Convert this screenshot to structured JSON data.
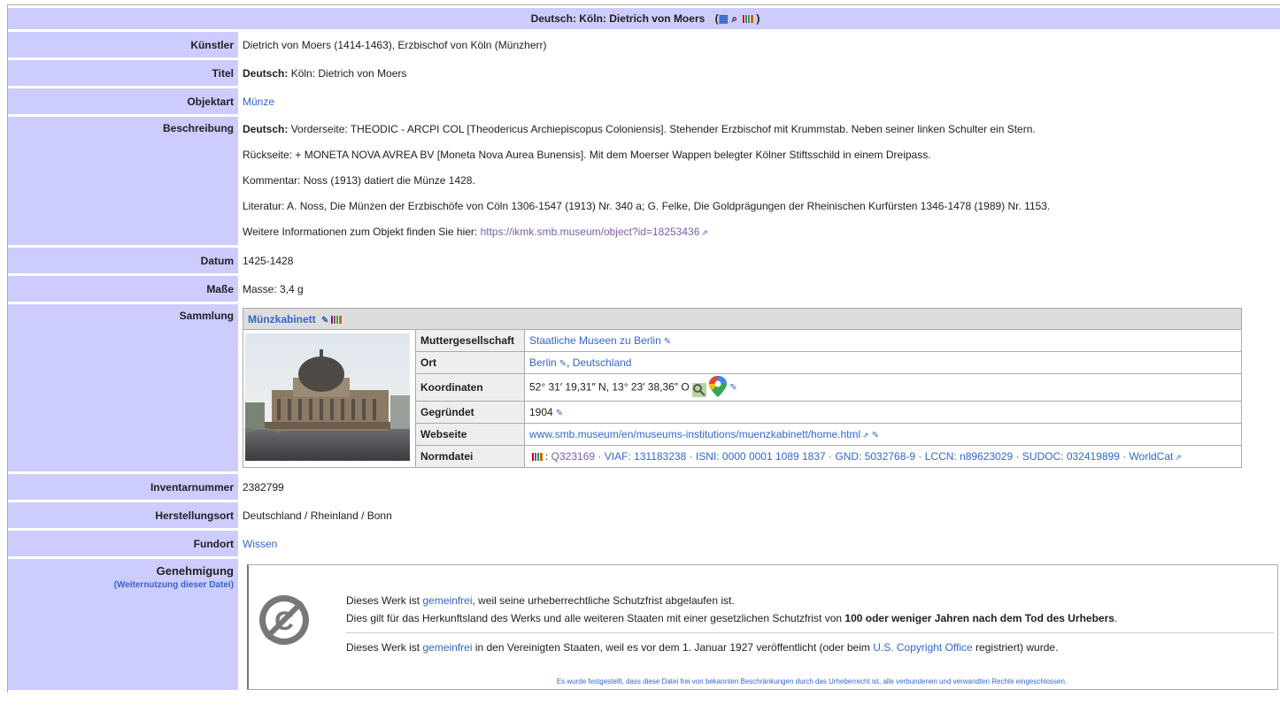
{
  "header": {
    "title": "Deutsch: Köln: Dietrich von Moers",
    "icons": [
      "map-icon",
      "search-icon",
      "barcode-icon"
    ]
  },
  "rows": {
    "kuenstler": {
      "label": "Künstler",
      "value": "Dietrich von Moers (1414-1463), Erzbischof von Köln (Münzherr)"
    },
    "titel": {
      "label": "Titel",
      "lang": "Deutsch:",
      "value": "Köln: Dietrich von Moers"
    },
    "objektart": {
      "label": "Objektart",
      "value": "Münze"
    },
    "beschreibung": {
      "label": "Beschreibung",
      "lang": "Deutsch:",
      "line1": "Vorderseite: THEODIC - ARCPI COL [Theodericus Archiepiscopus Coloniensis]. Stehender Erzbischof mit Krummstab. Neben seiner linken Schulter ein Stern.",
      "line2": "Rückseite: + MONETA NOVA AVREA BV [Moneta Nova Aurea Bunensis]. Mit dem Moerser Wappen belegter Kölner Stiftsschild in einem Dreipass.",
      "line3": "Kommentar: Noss (1913) datiert die Münze 1428.",
      "line4": "Literatur: A. Noss, Die Münzen der Erzbischöfe von Cöln 1306-1547 (1913) Nr. 340 a; G. Felke, Die Goldprägungen der Rheinischen Kurfürsten 1346-1478 (1989) Nr. 1153.",
      "line5_prefix": "Weitere Informationen zum Objekt finden Sie hier: ",
      "line5_link": "https://ikmk.smb.museum/object?id=18253436"
    },
    "datum": {
      "label": "Datum",
      "value": "1425-1428"
    },
    "masse": {
      "label": "Maße",
      "value": "Masse: 3,4 g"
    },
    "sammlung": {
      "label": "Sammlung",
      "name": "Münzkabinett",
      "rows": {
        "mutter": {
          "label": "Muttergesellschaft",
          "value": "Staatliche Museen zu Berlin"
        },
        "ort": {
          "label": "Ort",
          "city": "Berlin",
          "country": "Deutschland"
        },
        "koord": {
          "label": "Koordinaten",
          "value": "52° 31′ 19,31″ N, 13° 23′ 38,36″ O"
        },
        "gegr": {
          "label": "Gegründet",
          "value": "1904"
        },
        "web": {
          "label": "Webseite",
          "value": "www.smb.museum/en/museums-institutions/muenzkabinett/home.html"
        },
        "norm": {
          "label": "Normdatei",
          "q": "Q323169",
          "rest": " · VIAF: 131183238 · ISNI: 0000 0001 1089 1837 · GND: 5032768-9 · LCCN: n89623029 · SUDOC: 032419899 · ",
          "worldcat": "WorldCat"
        }
      }
    },
    "inventar": {
      "label": "Inventarnummer",
      "value": "2382799"
    },
    "herst": {
      "label": "Herstellungsort",
      "value": "Deutschland / Rheinland / Bonn"
    },
    "fundort": {
      "label": "Fundort",
      "value": "Wissen"
    },
    "genehmigung": {
      "label": "Genehmigung",
      "sublink": "(Weiternutzung dieser Datei)",
      "p1_a": "Dieses Werk ist ",
      "p1_link": "gemeinfrei",
      "p1_b": ", weil seine urheberrechtliche Schutzfrist abgelaufen ist.",
      "p2_a": "Dies gilt für das Herkunftsland des Werks und alle weiteren Staaten mit einer gesetzlichen Schutzfrist von ",
      "p2_bold": "100 oder weniger Jahren nach dem Tod des Urhebers",
      "p2_b": ".",
      "p3_a": "Dieses Werk ist ",
      "p3_link": "gemeinfrei",
      "p3_b": " in den Vereinigten Staaten, weil es vor dem 1. Januar 1927 veröffentlicht (oder beim ",
      "p3_link2": "U.S. Copyright Office",
      "p3_c": " registriert) wurde.",
      "small": "Es wurde festgestellt, dass diese Datei frei von bekannten Beschränkungen durch das Urheberrecht ist, alle verbundenen und verwandten Rechte eingeschlossen."
    }
  },
  "colors": {
    "header_bg": "#ccccff",
    "link": "#3366cc",
    "visited": "#795cb2"
  }
}
